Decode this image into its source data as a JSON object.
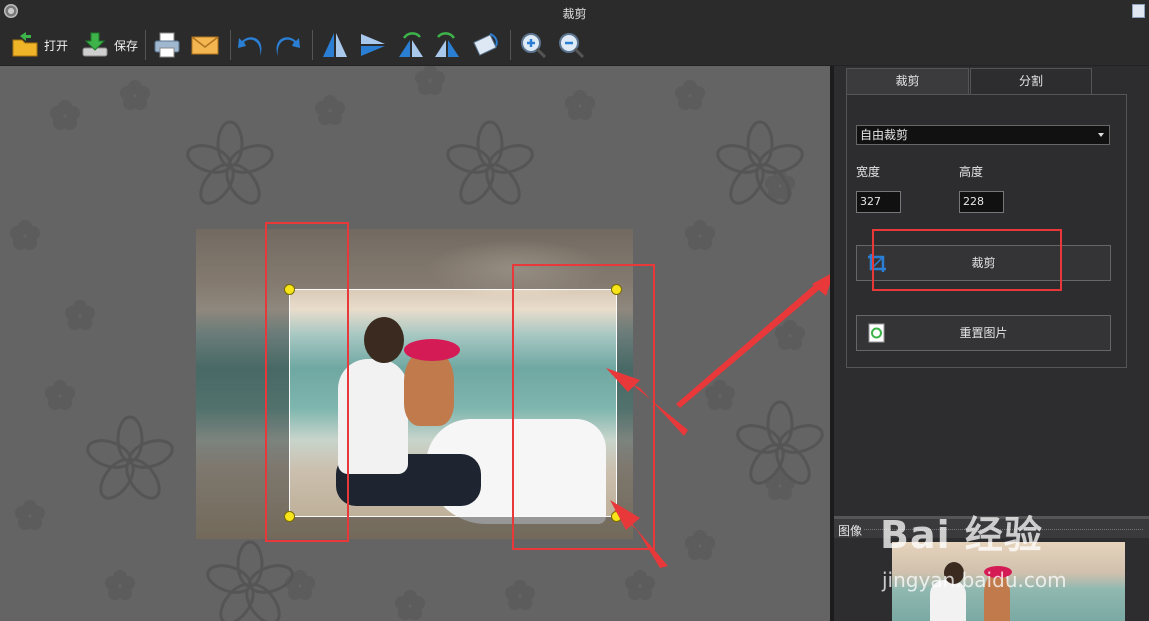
{
  "window": {
    "title": "裁剪"
  },
  "toolbar": {
    "open_label": "打开",
    "save_label": "保存",
    "icons": [
      "open-folder-icon",
      "save-download-icon",
      "print-icon",
      "email-icon",
      "undo-icon",
      "redo-icon",
      "flip-horizontal-icon",
      "flip-vertical-icon",
      "rotate-left-icon",
      "rotate-right-icon",
      "rotate-free-icon",
      "zoom-in-icon",
      "zoom-out-icon"
    ]
  },
  "panel": {
    "tabs": [
      {
        "label": "裁剪",
        "active": true
      },
      {
        "label": "分割",
        "active": false
      }
    ],
    "crop_mode": {
      "selected": "自由裁剪"
    },
    "width_label": "宽度",
    "height_label": "高度",
    "width_value": "327",
    "height_value": "228",
    "crop_button_label": "裁剪",
    "reset_button_label": "重置图片",
    "image_section_label": "图像"
  },
  "watermark": {
    "text": "Bai 经验",
    "sub": "jingyan.baidu.com"
  },
  "colors": {
    "annotation_red": "#e8383a",
    "handle_yellow": "#f7e51a",
    "accent_blue": "#2a7fd4"
  }
}
